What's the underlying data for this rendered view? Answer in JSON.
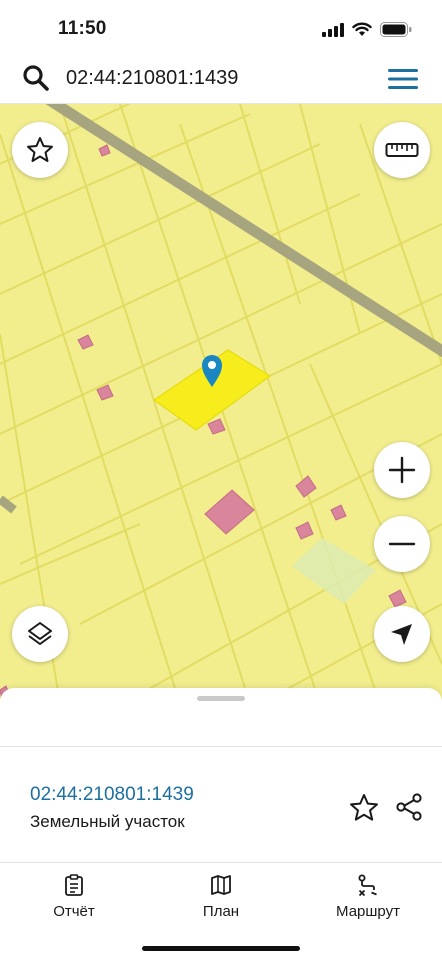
{
  "status_bar": {
    "time": "11:50"
  },
  "search": {
    "query": "02:44:210801:1439"
  },
  "parcel": {
    "cadastral_number": "02:44:210801:1439",
    "type": "Земельный участок"
  },
  "tabs": [
    {
      "label": "Отчёт",
      "icon": "report-icon"
    },
    {
      "label": "План",
      "icon": "map-plan-icon"
    },
    {
      "label": "Маршрут",
      "icon": "route-icon"
    }
  ],
  "colors": {
    "map_background": "#f2ee8e",
    "parcel_lines": "#e4de6a",
    "road": "#a7a57f",
    "selected_parcel": "#f7ec1c",
    "buildings": "#d9859b",
    "accent_blue": "#1d6fa0",
    "marker": "#1a86c2"
  }
}
